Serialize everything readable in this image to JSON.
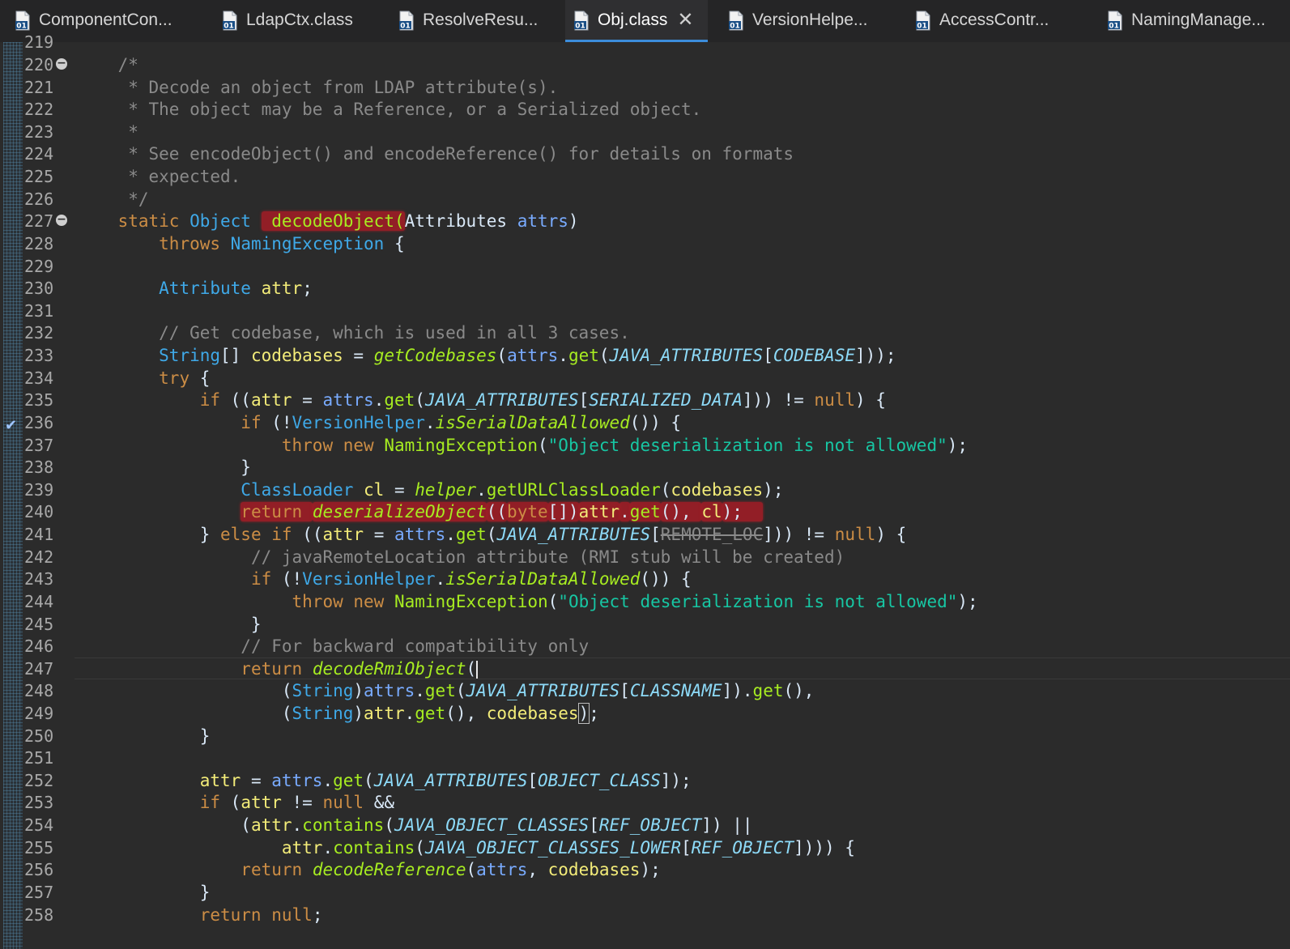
{
  "tabs": [
    {
      "label": "ComponentCon...",
      "active": false
    },
    {
      "label": "LdapCtx.class",
      "active": false
    },
    {
      "label": "ResolveResu...",
      "active": false
    },
    {
      "label": "Obj.class",
      "active": true
    },
    {
      "label": "VersionHelpe...",
      "active": false
    },
    {
      "label": "AccessContr...",
      "active": false
    },
    {
      "label": "NamingManage...",
      "active": false
    }
  ],
  "icons": {
    "class_file": "class-file-icon",
    "close": "close-icon",
    "fold": "fold-collapse-icon",
    "breakpoint": "breakpoint-check-icon"
  },
  "colors": {
    "background": "#2b2b2b",
    "keyword": "#cc8d45",
    "type": "#3fa9e8",
    "method": "#a7ec21",
    "string": "#17c6a3",
    "comment": "#8a8a8a",
    "highlight": "#aa1c26",
    "active_tab_underline": "#3c8ddb"
  },
  "editor": {
    "first_line_partial": "219",
    "lines": [
      {
        "n": "220",
        "fold": true,
        "t": [
          [
            "cm",
            "    /*"
          ]
        ]
      },
      {
        "n": "221",
        "t": [
          [
            "cm",
            "     * Decode an object from LDAP attribute(s)."
          ]
        ]
      },
      {
        "n": "222",
        "t": [
          [
            "cm",
            "     * The object may be a Reference, or a Serialized object."
          ]
        ]
      },
      {
        "n": "223",
        "t": [
          [
            "cm",
            "     *"
          ]
        ]
      },
      {
        "n": "224",
        "t": [
          [
            "cm",
            "     * See encodeObject() and encodeReference() for details on formats"
          ]
        ]
      },
      {
        "n": "225",
        "t": [
          [
            "cm",
            "     * expected."
          ]
        ]
      },
      {
        "n": "226",
        "t": [
          [
            "cm",
            "     */"
          ]
        ]
      },
      {
        "n": "227",
        "fold": true,
        "t": [
          [
            "pl",
            "    "
          ],
          [
            "kw",
            "static"
          ],
          [
            "pl",
            " "
          ],
          [
            "ty",
            "Object"
          ],
          [
            "pl",
            " "
          ],
          [
            "fnc hl",
            " decodeObject("
          ],
          [
            "pl",
            "Attributes "
          ],
          [
            "vr",
            "attrs"
          ],
          [
            "pl",
            ")"
          ]
        ]
      },
      {
        "n": "228",
        "t": [
          [
            "pl",
            "        "
          ],
          [
            "kw",
            "throws"
          ],
          [
            "pl",
            " "
          ],
          [
            "ty",
            "NamingException"
          ],
          [
            "pl",
            " {"
          ]
        ]
      },
      {
        "n": "229",
        "t": [
          [
            "pl",
            " "
          ]
        ]
      },
      {
        "n": "230",
        "t": [
          [
            "pl",
            "        "
          ],
          [
            "ty",
            "Attribute"
          ],
          [
            "pl",
            " "
          ],
          [
            "lc",
            "attr"
          ],
          [
            "pl",
            ";"
          ]
        ]
      },
      {
        "n": "231",
        "t": [
          [
            "pl",
            " "
          ]
        ]
      },
      {
        "n": "232",
        "t": [
          [
            "pl",
            "        "
          ],
          [
            "cm",
            "// Get codebase, which is used in all 3 cases."
          ]
        ]
      },
      {
        "n": "233",
        "t": [
          [
            "pl",
            "        "
          ],
          [
            "ty",
            "String"
          ],
          [
            "pl",
            "[] "
          ],
          [
            "lc",
            "codebases"
          ],
          [
            "pl",
            " = "
          ],
          [
            "fi",
            "getCodebases"
          ],
          [
            "pl",
            "("
          ],
          [
            "vr",
            "attrs"
          ],
          [
            "pl",
            "."
          ],
          [
            "fnc",
            "get"
          ],
          [
            "pl",
            "("
          ],
          [
            "cn",
            "JAVA_ATTRIBUTES"
          ],
          [
            "pl",
            "["
          ],
          [
            "cn",
            "CODEBASE"
          ],
          [
            "pl",
            "]));"
          ]
        ]
      },
      {
        "n": "234",
        "t": [
          [
            "pl",
            "        "
          ],
          [
            "kw",
            "try"
          ],
          [
            "pl",
            " {"
          ]
        ]
      },
      {
        "n": "235",
        "t": [
          [
            "pl",
            "            "
          ],
          [
            "kw",
            "if"
          ],
          [
            "pl",
            " (("
          ],
          [
            "lc",
            "attr"
          ],
          [
            "pl",
            " = "
          ],
          [
            "vr",
            "attrs"
          ],
          [
            "pl",
            "."
          ],
          [
            "fnc",
            "get"
          ],
          [
            "pl",
            "("
          ],
          [
            "cn",
            "JAVA_ATTRIBUTES"
          ],
          [
            "pl",
            "["
          ],
          [
            "cn",
            "SERIALIZED_DATA"
          ],
          [
            "pl",
            "])) != "
          ],
          [
            "kw",
            "null"
          ],
          [
            "pl",
            ") {"
          ]
        ]
      },
      {
        "n": "236",
        "bp": true,
        "t": [
          [
            "pl",
            "                "
          ],
          [
            "kw",
            "if"
          ],
          [
            "pl",
            " (!"
          ],
          [
            "ty",
            "VersionHelper"
          ],
          [
            "pl",
            "."
          ],
          [
            "fi",
            "isSerialDataAllowed"
          ],
          [
            "pl",
            "()) {"
          ]
        ]
      },
      {
        "n": "237",
        "t": [
          [
            "pl",
            "                    "
          ],
          [
            "kw",
            "throw"
          ],
          [
            "pl",
            " "
          ],
          [
            "kw",
            "new"
          ],
          [
            "pl",
            " "
          ],
          [
            "fnc",
            "NamingException"
          ],
          [
            "pl",
            "("
          ],
          [
            "st",
            "\"Object deserialization is not allowed\""
          ],
          [
            "pl",
            ");"
          ]
        ]
      },
      {
        "n": "238",
        "t": [
          [
            "pl",
            "                }"
          ]
        ]
      },
      {
        "n": "239",
        "t": [
          [
            "pl",
            "                "
          ],
          [
            "ty",
            "ClassLoader"
          ],
          [
            "pl",
            " "
          ],
          [
            "lc",
            "cl"
          ],
          [
            "pl",
            " = "
          ],
          [
            "fi",
            "helper"
          ],
          [
            "pl",
            "."
          ],
          [
            "fnc",
            "getURLClassLoader"
          ],
          [
            "pl",
            "("
          ],
          [
            "lc",
            "codebases"
          ],
          [
            "pl",
            ");"
          ]
        ]
      },
      {
        "n": "240",
        "t": [
          [
            "pl",
            "                "
          ],
          [
            "kw hl",
            "return "
          ],
          [
            "fi hl",
            "deserializeObject"
          ],
          [
            "pl hl",
            "(("
          ],
          [
            "kw hl",
            "byte"
          ],
          [
            "pl hl",
            "[])"
          ],
          [
            "lc hl",
            "attr"
          ],
          [
            "pl hl",
            "."
          ],
          [
            "fnc hl",
            "get"
          ],
          [
            "pl hl",
            "(), "
          ],
          [
            "lc hl",
            "cl"
          ],
          [
            "pl hl",
            ");  "
          ]
        ]
      },
      {
        "n": "241",
        "t": [
          [
            "pl",
            "            } "
          ],
          [
            "kw",
            "else"
          ],
          [
            "pl",
            " "
          ],
          [
            "kw",
            "if"
          ],
          [
            "pl",
            " (("
          ],
          [
            "lc",
            "attr"
          ],
          [
            "pl",
            " = "
          ],
          [
            "vr",
            "attrs"
          ],
          [
            "pl",
            "."
          ],
          [
            "fnc",
            "get"
          ],
          [
            "pl",
            "("
          ],
          [
            "cn",
            "JAVA_ATTRIBUTES"
          ],
          [
            "pl",
            "["
          ],
          [
            "dep",
            "REMOTE_LOC"
          ],
          [
            "pl",
            "])) != "
          ],
          [
            "kw",
            "null"
          ],
          [
            "pl",
            ") {"
          ]
        ]
      },
      {
        "n": "242",
        "t": [
          [
            "pl",
            "                 "
          ],
          [
            "cm",
            "// javaRemoteLocation attribute (RMI stub will be created)"
          ]
        ]
      },
      {
        "n": "243",
        "t": [
          [
            "pl",
            "                 "
          ],
          [
            "kw",
            "if"
          ],
          [
            "pl",
            " (!"
          ],
          [
            "ty",
            "VersionHelper"
          ],
          [
            "pl",
            "."
          ],
          [
            "fi",
            "isSerialDataAllowed"
          ],
          [
            "pl",
            "()) {"
          ]
        ]
      },
      {
        "n": "244",
        "t": [
          [
            "pl",
            "                     "
          ],
          [
            "kw",
            "throw"
          ],
          [
            "pl",
            " "
          ],
          [
            "kw",
            "new"
          ],
          [
            "pl",
            " "
          ],
          [
            "fnc",
            "NamingException"
          ],
          [
            "pl",
            "("
          ],
          [
            "st",
            "\"Object deserialization is not allowed\""
          ],
          [
            "pl",
            ");"
          ]
        ]
      },
      {
        "n": "245",
        "t": [
          [
            "pl",
            "                 }"
          ]
        ]
      },
      {
        "n": "246",
        "t": [
          [
            "pl",
            "                "
          ],
          [
            "cm",
            "// For backward compatibility only"
          ]
        ]
      },
      {
        "n": "247",
        "cur": true,
        "t": [
          [
            "pl",
            "                "
          ],
          [
            "kw",
            "return"
          ],
          [
            "pl",
            " "
          ],
          [
            "fi",
            "decodeRmiObject"
          ],
          [
            "pl",
            "("
          ],
          [
            "cursor",
            ""
          ]
        ]
      },
      {
        "n": "248",
        "t": [
          [
            "pl",
            "                    ("
          ],
          [
            "ty",
            "String"
          ],
          [
            "pl",
            ")"
          ],
          [
            "vr",
            "attrs"
          ],
          [
            "pl",
            "."
          ],
          [
            "fnc",
            "get"
          ],
          [
            "pl",
            "("
          ],
          [
            "cn",
            "JAVA_ATTRIBUTES"
          ],
          [
            "pl",
            "["
          ],
          [
            "cn",
            "CLASSNAME"
          ],
          [
            "pl",
            "])."
          ],
          [
            "fnc",
            "get"
          ],
          [
            "pl",
            "(),"
          ]
        ]
      },
      {
        "n": "249",
        "t": [
          [
            "pl",
            "                    ("
          ],
          [
            "ty",
            "String"
          ],
          [
            "pl",
            ")"
          ],
          [
            "lc",
            "attr"
          ],
          [
            "pl",
            "."
          ],
          [
            "fnc",
            "get"
          ],
          [
            "pl",
            "(), "
          ],
          [
            "lc",
            "codebases"
          ],
          [
            "pl bracketbox",
            ")"
          ],
          [
            "pl",
            ";"
          ]
        ]
      },
      {
        "n": "250",
        "t": [
          [
            "pl",
            "            }"
          ]
        ]
      },
      {
        "n": "251",
        "t": [
          [
            "pl",
            " "
          ]
        ]
      },
      {
        "n": "252",
        "t": [
          [
            "pl",
            "            "
          ],
          [
            "lc",
            "attr"
          ],
          [
            "pl",
            " = "
          ],
          [
            "vr",
            "attrs"
          ],
          [
            "pl",
            "."
          ],
          [
            "fnc",
            "get"
          ],
          [
            "pl",
            "("
          ],
          [
            "cn",
            "JAVA_ATTRIBUTES"
          ],
          [
            "pl",
            "["
          ],
          [
            "cn",
            "OBJECT_CLASS"
          ],
          [
            "pl",
            "]);"
          ]
        ]
      },
      {
        "n": "253",
        "t": [
          [
            "pl",
            "            "
          ],
          [
            "kw",
            "if"
          ],
          [
            "pl",
            " ("
          ],
          [
            "lc",
            "attr"
          ],
          [
            "pl",
            " != "
          ],
          [
            "kw",
            "null"
          ],
          [
            "pl",
            " &&"
          ]
        ]
      },
      {
        "n": "254",
        "t": [
          [
            "pl",
            "                ("
          ],
          [
            "lc",
            "attr"
          ],
          [
            "pl",
            "."
          ],
          [
            "fnc",
            "contains"
          ],
          [
            "pl",
            "("
          ],
          [
            "cn",
            "JAVA_OBJECT_CLASSES"
          ],
          [
            "pl",
            "["
          ],
          [
            "cn",
            "REF_OBJECT"
          ],
          [
            "pl",
            "]) ||"
          ]
        ]
      },
      {
        "n": "255",
        "t": [
          [
            "pl",
            "                    "
          ],
          [
            "lc",
            "attr"
          ],
          [
            "pl",
            "."
          ],
          [
            "fnc",
            "contains"
          ],
          [
            "pl",
            "("
          ],
          [
            "cn",
            "JAVA_OBJECT_CLASSES_LOWER"
          ],
          [
            "pl",
            "["
          ],
          [
            "cn",
            "REF_OBJECT"
          ],
          [
            "pl",
            "]))) {"
          ]
        ]
      },
      {
        "n": "256",
        "t": [
          [
            "pl",
            "                "
          ],
          [
            "kw",
            "return"
          ],
          [
            "pl",
            " "
          ],
          [
            "fi",
            "decodeReference"
          ],
          [
            "pl",
            "("
          ],
          [
            "vr",
            "attrs"
          ],
          [
            "pl",
            ", "
          ],
          [
            "lc",
            "codebases"
          ],
          [
            "pl",
            ");"
          ]
        ]
      },
      {
        "n": "257",
        "t": [
          [
            "pl",
            "            }"
          ]
        ]
      },
      {
        "n": "258",
        "t": [
          [
            "pl",
            "            "
          ],
          [
            "kw",
            "return"
          ],
          [
            "pl",
            " "
          ],
          [
            "kw",
            "null"
          ],
          [
            "pl",
            ";"
          ]
        ]
      }
    ]
  }
}
